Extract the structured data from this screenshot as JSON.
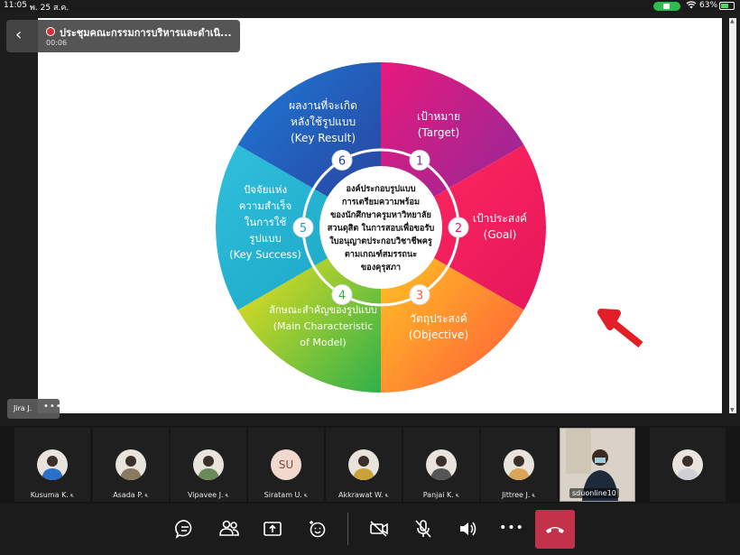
{
  "status_bar": {
    "time": "11:05",
    "date": "พ. 25 ส.ค.",
    "battery": "63%",
    "battery_level": 0.63,
    "icons": [
      "camera-indicator-icon",
      "wifi-icon",
      "battery-icon"
    ]
  },
  "meeting": {
    "title": "ประชุมคณะกรรมการบริหารและดำเนิ...",
    "duration": "00:06"
  },
  "presenter": {
    "name": "Jira J.",
    "more": "•••"
  },
  "slide": {
    "center_text": [
      "องค์ประกอบรูปแบบ",
      "การเตรียมความพร้อม",
      "ของนักศึกษาครูมหาวิทยาลัย",
      "สวนดุสิต ในการสอบเพื่อขอรับ",
      "ใบอนุญาตประกอบวิชาชีพครู",
      "ตามเกณฑ์สมรรถนะ",
      "ของคุรุสภา"
    ],
    "segments": [
      {
        "number": "1",
        "line1": "เป้าหมาย",
        "line2": "(Target)",
        "color_start": "#e8197d",
        "color_end": "#8b2a9b"
      },
      {
        "number": "2",
        "line1": "เป้าประสงค์",
        "line2": "(Goal)",
        "color_start": "#ff2a5e",
        "color_end": "#e6165c"
      },
      {
        "number": "3",
        "line1": "วัตถุประสงค์",
        "line2": "(Objective)",
        "color_start": "#ffcc22",
        "color_end": "#ff5a3a"
      },
      {
        "number": "4",
        "line1": "ลักษณะสำคัญของรูปแบบ",
        "line2": "(Main Characteristic",
        "line3": "of Model)",
        "color_start": "#ffe41c",
        "color_end": "#2fb04a"
      },
      {
        "number": "5",
        "line1": "ปัจจัยแห่ง",
        "line2": "ความสำเร็จ",
        "line3": "ในการใช้",
        "line4": "รูปแบบ",
        "line5": "(Key Success)",
        "color_start": "#2fc0dc",
        "color_end": "#1aa3c4"
      },
      {
        "number": "6",
        "line1": "ผลงานที่จะเกิด",
        "line2": "หลังใช้รูปแบบ",
        "line3": "(Key Result)",
        "color_start": "#1d7bd6",
        "color_end": "#2a3f9c"
      }
    ],
    "annotation_color": "#e21f26"
  },
  "participants": [
    {
      "name": "Kusuma K.",
      "avatar_color": "#2a6fc9"
    },
    {
      "name": "Asada P.",
      "avatar_color": "#8a7a60"
    },
    {
      "name": "Vipavee J.",
      "avatar_color": "#6a8a5a"
    },
    {
      "name": "Siratam U.",
      "initials": "SU"
    },
    {
      "name": "Akkrawat W.",
      "avatar_color": "#c9a23a"
    },
    {
      "name": "Panjai K.",
      "avatar_color": "#555555"
    },
    {
      "name": "Jittree J.",
      "avatar_color": "#d9a55a"
    },
    {
      "name": "sduonline10",
      "video": true
    },
    {
      "name": "",
      "avatar_color": "#cfcfd6"
    }
  ],
  "toolbar": {
    "icons": [
      "chat-icon",
      "people-icon",
      "share-screen-icon",
      "reactions-icon",
      "camera-off-icon",
      "mic-off-icon",
      "speaker-icon",
      "more-icon",
      "hang-up-icon"
    ],
    "more_label": "•••"
  }
}
